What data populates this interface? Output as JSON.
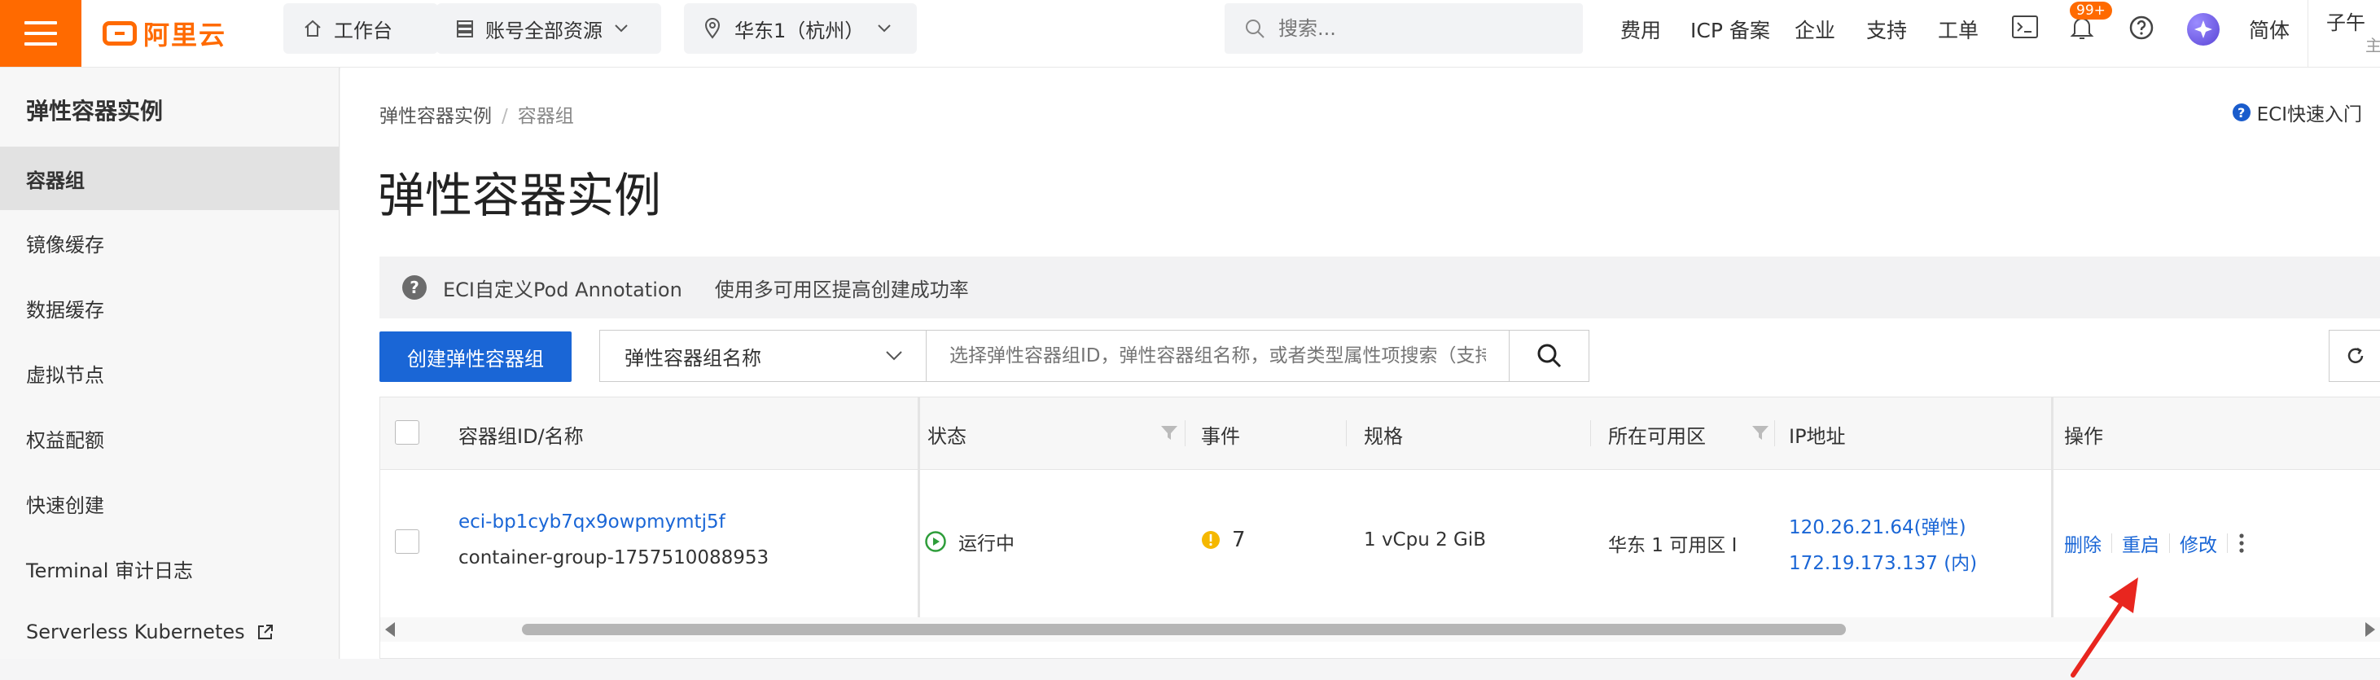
{
  "topbar": {
    "logo_text": "阿里云",
    "workbench": "工作台",
    "resources": "账号全部资源",
    "region": "华东1（杭州）",
    "search_placeholder": "搜索...",
    "nav_fee": "费用",
    "nav_icp": "ICP 备案",
    "nav_enterprise": "企业",
    "nav_support": "支持",
    "nav_ticket": "工单",
    "notification_count": "99+",
    "language": "简体",
    "user_name": "子午",
    "user_sub": "主"
  },
  "sidebar": {
    "title": "弹性容器实例",
    "items": [
      {
        "label": "容器组",
        "active": true
      },
      {
        "label": "镜像缓存",
        "active": false
      },
      {
        "label": "数据缓存",
        "active": false
      },
      {
        "label": "虚拟节点",
        "active": false
      },
      {
        "label": "权益配额",
        "active": false
      },
      {
        "label": "快速创建",
        "active": false
      },
      {
        "label": "Terminal 审计日志",
        "active": false
      },
      {
        "label": "Serverless Kubernetes",
        "active": false
      }
    ]
  },
  "breadcrumb": {
    "root": "弹性容器实例",
    "separator": "/",
    "current": "容器组"
  },
  "quick_start": "ECI快速入门",
  "page_title": "弹性容器实例",
  "notice": {
    "link1": "ECI自定义Pod Annotation",
    "link2": "使用多可用区提高创建成功率"
  },
  "toolbar": {
    "create_label": "创建弹性容器组",
    "filter_field": "弹性容器组名称",
    "filter_placeholder": "选择弹性容器组ID，弹性容器组名称，或者类型属性项搜索（支持模糊搜索）"
  },
  "table": {
    "headers": {
      "id_name": "容器组ID/名称",
      "status": "状态",
      "events": "事件",
      "spec": "规格",
      "zone": "所在可用区",
      "ip": "IP地址",
      "actions": "操作"
    },
    "rows": [
      {
        "id": "eci-bp1cyb7qx9owpmymtj5f",
        "name": "container-group-1757510088953",
        "status": "运行中",
        "events": "7",
        "spec": "1 vCpu 2 GiB",
        "zone": "华东 1 可用区 I",
        "ip_public": "120.26.21.64(弹性)",
        "ip_private": "172.19.173.137 (内)",
        "actions": [
          "删除",
          "重启",
          "修改"
        ]
      }
    ]
  },
  "colors": {
    "brand": "#ff6a00",
    "primary": "#1a66d6",
    "annotation": "#e8261f"
  }
}
